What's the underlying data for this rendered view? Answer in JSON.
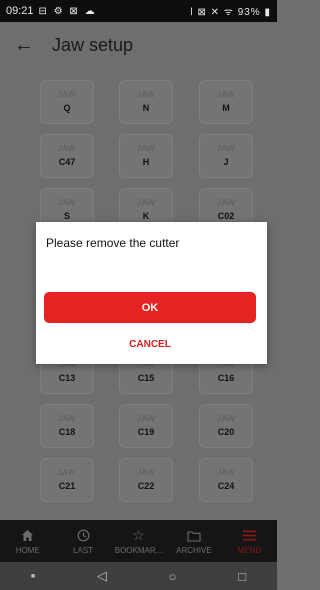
{
  "status_bar": {
    "time": "09:21",
    "left_icons": "⊟ ⚙ ⊠ ☁",
    "right_icons": "ǀ ⊠ ✕ ᯤ",
    "battery": "93%"
  },
  "header": {
    "title": "Jaw setup"
  },
  "jaw_grid": {
    "label": "JAW",
    "cells": [
      "Q",
      "N",
      "M",
      "C47",
      "H",
      "J",
      "S",
      "K",
      "C02",
      "C13",
      "C15",
      "C16",
      "C18",
      "C19",
      "C20",
      "C21",
      "C22",
      "C24"
    ]
  },
  "dialog": {
    "message": "Please remove the cutter",
    "ok_label": "OK",
    "cancel_label": "CANCEL"
  },
  "bottom_nav": {
    "items": [
      {
        "label": "HOME",
        "icon": "home-icon"
      },
      {
        "label": "LAST",
        "icon": "clock-icon"
      },
      {
        "label": "BOOKMAR...",
        "icon": "star-icon"
      },
      {
        "label": "ARCHIVE",
        "icon": "folder-icon"
      },
      {
        "label": "MENU",
        "icon": "menu-icon"
      }
    ]
  },
  "system_nav": {
    "items": [
      "recent-dot",
      "back",
      "home",
      "overview"
    ]
  },
  "colors": {
    "overlay_background": "#6e6e6e",
    "accent_red": "#e52323",
    "cancel_red": "#d71f1f",
    "nav_bg": "#151515"
  }
}
